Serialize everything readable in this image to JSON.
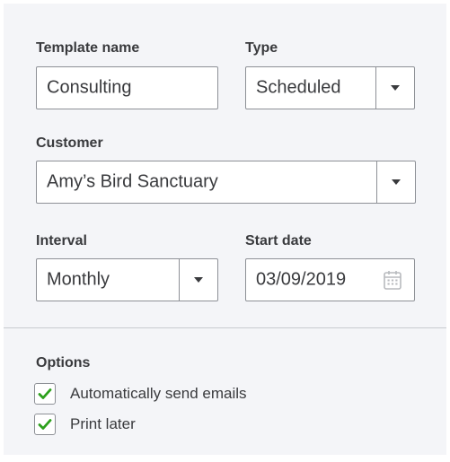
{
  "form": {
    "template_name": {
      "label": "Template name",
      "value": "Consulting"
    },
    "type": {
      "label": "Type",
      "value": "Scheduled"
    },
    "customer": {
      "label": "Customer",
      "value": "Amy’s Bird Sanctuary"
    },
    "interval": {
      "label": "Interval",
      "value": "Monthly"
    },
    "start_date": {
      "label": "Start date",
      "value": "03/09/2019"
    }
  },
  "options": {
    "title": "Options",
    "items": [
      {
        "label": "Automatically send emails",
        "checked": true
      },
      {
        "label": "Print later",
        "checked": true
      }
    ]
  },
  "colors": {
    "panel_bg": "#f4f5f8",
    "check_green": "#2ca01c",
    "border": "#8d9096",
    "text": "#393a3d"
  },
  "icons": {
    "dropdown": "chevron-down-icon",
    "calendar": "calendar-icon",
    "checkmark": "checkmark-icon"
  }
}
